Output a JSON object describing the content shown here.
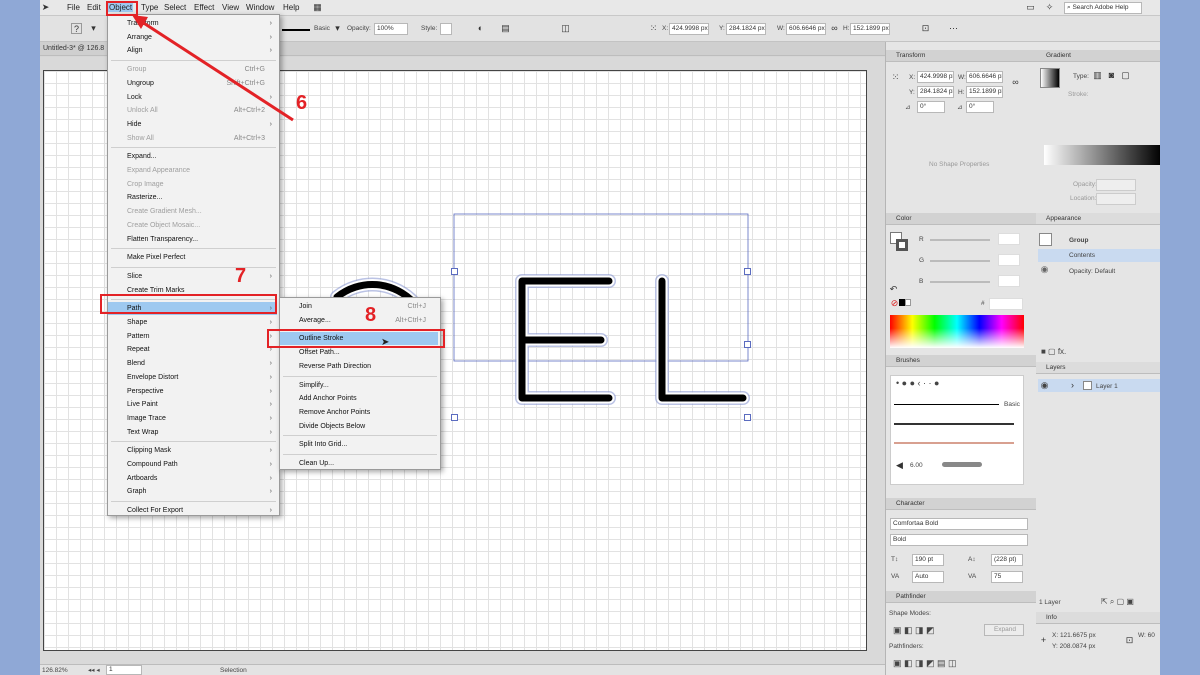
{
  "menubar": {
    "items": [
      "File",
      "Edit",
      "Object",
      "Type",
      "Select",
      "Effect",
      "View",
      "Window",
      "Help"
    ],
    "search_placeholder": "Search Adobe Help"
  },
  "control": {
    "stroke_style": "Basic",
    "opacity_label": "Opacity:",
    "opacity_value": "100%",
    "style_label": "Style:",
    "x_label": "X:",
    "x_value": "424.9998 px",
    "y_label": "Y:",
    "y_value": "284.1824 px",
    "w_label": "W:",
    "w_value": "606.6646 px",
    "h_label": "H:",
    "h_value": "152.1899 px"
  },
  "doc": {
    "tab_title": "Untitled-3* @ 126.8",
    "zoom": "126.82%",
    "page": "1",
    "tool": "Selection"
  },
  "object_menu": [
    {
      "label": "Transform",
      "arrow": true
    },
    {
      "label": "Arrange",
      "arrow": true
    },
    {
      "label": "Align",
      "arrow": true
    },
    {
      "sep": true
    },
    {
      "label": "Group",
      "shortcut": "Ctrl+G",
      "disabled": true
    },
    {
      "label": "Ungroup",
      "shortcut": "Shift+Ctrl+G"
    },
    {
      "label": "Lock",
      "arrow": true
    },
    {
      "label": "Unlock All",
      "shortcut": "Alt+Ctrl+2",
      "disabled": true
    },
    {
      "label": "Hide",
      "arrow": true
    },
    {
      "label": "Show All",
      "shortcut": "Alt+Ctrl+3",
      "disabled": true
    },
    {
      "sep": true
    },
    {
      "label": "Expand..."
    },
    {
      "label": "Expand Appearance",
      "disabled": true
    },
    {
      "label": "Crop Image",
      "disabled": true
    },
    {
      "label": "Rasterize..."
    },
    {
      "label": "Create Gradient Mesh...",
      "disabled": true
    },
    {
      "label": "Create Object Mosaic...",
      "disabled": true
    },
    {
      "label": "Flatten Transparency..."
    },
    {
      "sep": true
    },
    {
      "label": "Make Pixel Perfect"
    },
    {
      "sep": true
    },
    {
      "label": "Slice",
      "arrow": true
    },
    {
      "label": "Create Trim Marks"
    },
    {
      "sep": true
    },
    {
      "label": "Path",
      "arrow": true,
      "highlight": true
    },
    {
      "label": "Shape",
      "arrow": true
    },
    {
      "label": "Pattern",
      "arrow": true
    },
    {
      "label": "Repeat",
      "arrow": true
    },
    {
      "label": "Blend",
      "arrow": true
    },
    {
      "label": "Envelope Distort",
      "arrow": true
    },
    {
      "label": "Perspective",
      "arrow": true
    },
    {
      "label": "Live Paint",
      "arrow": true
    },
    {
      "label": "Image Trace",
      "arrow": true
    },
    {
      "label": "Text Wrap",
      "arrow": true
    },
    {
      "sep": true
    },
    {
      "label": "Clipping Mask",
      "arrow": true
    },
    {
      "label": "Compound Path",
      "arrow": true
    },
    {
      "label": "Artboards",
      "arrow": true
    },
    {
      "label": "Graph",
      "arrow": true
    },
    {
      "sep": true
    },
    {
      "label": "Collect For Export",
      "arrow": true
    }
  ],
  "path_menu": [
    {
      "label": "Join",
      "shortcut": "Ctrl+J"
    },
    {
      "label": "Average...",
      "shortcut": "Alt+Ctrl+J"
    },
    {
      "sep": true
    },
    {
      "label": "Outline Stroke",
      "highlight": true
    },
    {
      "label": "Offset Path..."
    },
    {
      "label": "Reverse Path Direction"
    },
    {
      "sep": true
    },
    {
      "label": "Simplify..."
    },
    {
      "label": "Add Anchor Points"
    },
    {
      "label": "Remove Anchor Points"
    },
    {
      "label": "Divide Objects Below"
    },
    {
      "sep": true
    },
    {
      "label": "Split Into Grid..."
    },
    {
      "sep": true
    },
    {
      "label": "Clean Up..."
    }
  ],
  "annotations": {
    "n6": "6",
    "n7": "7",
    "n8": "8"
  },
  "panels": {
    "transform": {
      "title": "Transform",
      "x": "424.9998 px",
      "y": "284.1824 px",
      "w": "606.6646 px",
      "h": "152.1899 px",
      "angle": "0°",
      "shear": "0°",
      "no_shape": "No Shape Properties"
    },
    "gradient": {
      "title": "Gradient",
      "type_label": "Type:",
      "stroke_label": "Stroke:",
      "opacity_label": "Opacity:",
      "location_label": "Location:"
    },
    "color": {
      "title": "Color",
      "r": "R",
      "g": "G",
      "b": "B",
      "hash": "#"
    },
    "appearance": {
      "title": "Appearance",
      "group": "Group",
      "contents": "Contents",
      "opacity": "Opacity: Default"
    },
    "layers": {
      "title": "Layers",
      "layer1": "Layer 1",
      "count": "1 Layer"
    },
    "brushes": {
      "title": "Brushes",
      "basic": "Basic",
      "size": "6.00"
    },
    "character": {
      "title": "Character",
      "font": "Comfortaa Bold",
      "style": "Bold",
      "size": "190 pt",
      "leading": "(228 pt)",
      "kerning": "Auto",
      "tracking": "75"
    },
    "pathfinder": {
      "title": "Pathfinder",
      "shape_modes": "Shape Modes:",
      "pathfinders": "Pathfinders:",
      "expand": "Expand"
    },
    "info": {
      "title": "Info",
      "x": "X: 121.6675 px",
      "y": "Y: 208.0874 px",
      "w": "W: 60"
    }
  },
  "colors": {
    "annotation": "#e32226",
    "highlight": "#9ec9f0",
    "selection": "#5b6cc0"
  }
}
